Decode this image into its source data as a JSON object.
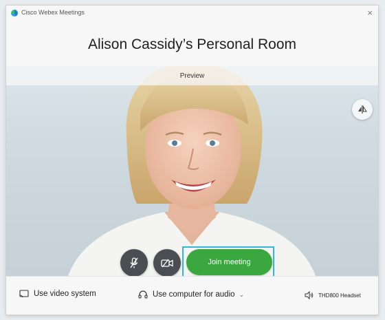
{
  "window": {
    "app_title": "Cisco Webex Meetings",
    "room_title": "Alison Cassidy’s Personal Room"
  },
  "stage": {
    "preview_label": "Preview"
  },
  "controls": {
    "join_label": "Join meeting",
    "mute_icon": "microphone-muted-icon",
    "video_icon": "camera-off-icon",
    "flip_icon": "flip-camera-icon"
  },
  "bottom_bar": {
    "video_system_label": "Use video system",
    "audio_label": "Use computer for audio",
    "audio_caret": "⌄",
    "headset_label": "THD800 Headset"
  },
  "colors": {
    "join_green": "#3aa83e",
    "highlight_blue": "#35b5d8",
    "control_dark": "#4a4e52"
  }
}
